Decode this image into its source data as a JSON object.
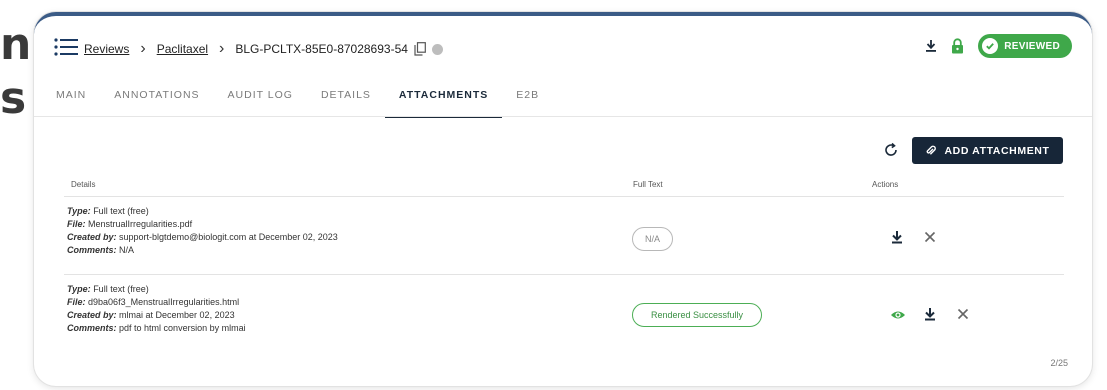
{
  "background": {
    "text_line1": "n",
    "text_line2": "s"
  },
  "header": {
    "breadcrumb": [
      "Reviews",
      "Paclitaxel",
      "BLG-PCLTX-85E0-87028693-54"
    ],
    "status_badge": "REVIEWED",
    "colors": {
      "brand_dark": "#172638",
      "success": "#3fa84a",
      "lock": "#3fa84a"
    }
  },
  "tabs": [
    "MAIN",
    "ANNOTATIONS",
    "AUDIT LOG",
    "DETAILS",
    "ATTACHMENTS",
    "E2B"
  ],
  "active_tab": "ATTACHMENTS",
  "toolbar": {
    "add_attachment": "ADD ATTACHMENT"
  },
  "table": {
    "columns": [
      "Details",
      "Full Text",
      "Actions"
    ],
    "rows": [
      {
        "type_label": "Type:",
        "type": "Full text (free)",
        "file_label": "File:",
        "file": "MenstrualIrregularities.pdf",
        "created_label": "Created by:",
        "created": "support-blgtdemo@biologit.com at December 02, 2023",
        "comments_label": "Comments:",
        "comments": "N/A",
        "full_text_status": "N/A",
        "actions": [
          "download-icon",
          "close-icon"
        ]
      },
      {
        "type_label": "Type:",
        "type": "Full text (free)",
        "file_label": "File:",
        "file": "d9ba06f3_MenstrualIrregularities.html",
        "created_label": "Created by:",
        "created": "mlmai at December 02, 2023",
        "comments_label": "Comments:",
        "comments": "pdf to html conversion by mlmai",
        "full_text_status": "Rendered Successfully",
        "actions": [
          "eye-icon",
          "download-icon",
          "close-icon"
        ]
      }
    ]
  },
  "pagination": "2/25"
}
